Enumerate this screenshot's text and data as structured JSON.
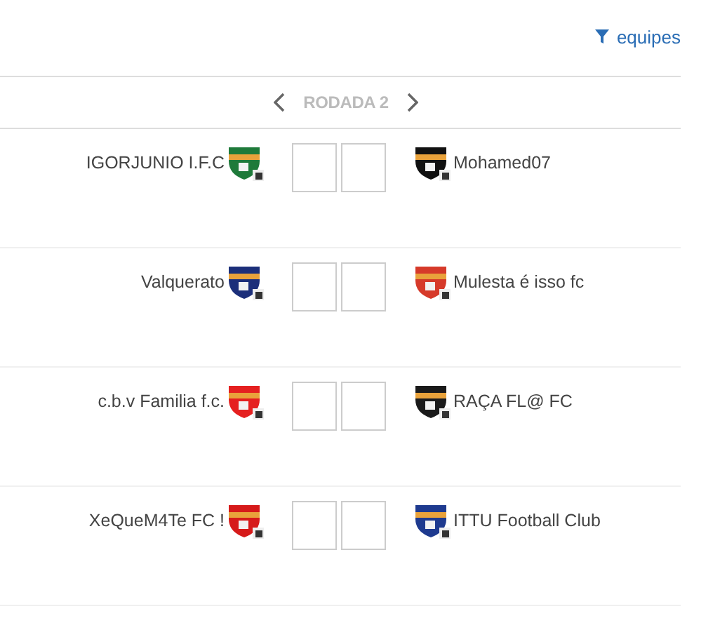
{
  "filter_link": {
    "label": "equipes"
  },
  "round_nav": {
    "title": "RODADA 2"
  },
  "matches": [
    {
      "home": {
        "name": "IGORJUNIO I.F.C",
        "crest": {
          "color": "#1e7a3a"
        }
      },
      "away": {
        "name": "Mohamed07",
        "crest": {
          "color": "#111111"
        }
      }
    },
    {
      "home": {
        "name": "Valquerato",
        "crest": {
          "color": "#1c2f7a"
        }
      },
      "away": {
        "name": "Mulesta é isso fc",
        "crest": {
          "color": "#d63a2a"
        }
      }
    },
    {
      "home": {
        "name": "c.b.v Familia f.c.",
        "crest": {
          "color": "#e52020"
        }
      },
      "away": {
        "name": "RAÇA FL@ FC",
        "crest": {
          "color": "#1a1a1a"
        }
      }
    },
    {
      "home": {
        "name": "XeQueM4Te FC !",
        "crest": {
          "color": "#d61a1a"
        }
      },
      "away": {
        "name": "ITTU Football Club",
        "crest": {
          "color": "#1e3a8f"
        }
      }
    }
  ]
}
